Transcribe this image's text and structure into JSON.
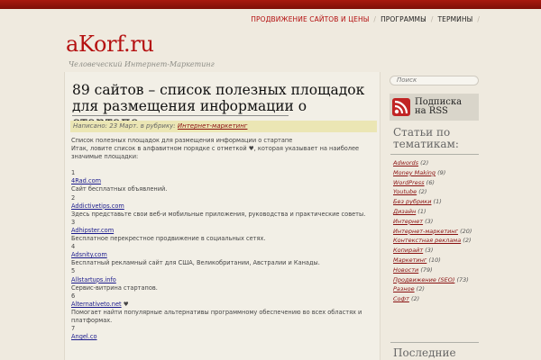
{
  "nav": {
    "items": [
      {
        "label": "ПРОДВИЖЕНИЕ САЙТОВ И ЦЕНЫ",
        "active": true
      },
      {
        "label": "ПРОГРАММЫ",
        "active": false
      },
      {
        "label": "ТЕРМИНЫ",
        "active": false
      }
    ]
  },
  "site": {
    "logo": "aKorf.ru",
    "tagline": "Человеческий Интернет-Маркетинг"
  },
  "post": {
    "title": "89 сайтов – список полезных площадок для размещения информации о стартапе",
    "meta_prefix": "Написано: 23 Март. в рубрику:",
    "meta_category": "Интернет-маркетинг",
    "intro1": "Список полезных площадок для размещения информации о стартапе",
    "intro2": "Итак, ловите список в алфавитном порядке с отметкой ♥, которая указывает на наиболее значимые площадки:",
    "entries": [
      {
        "num": "1",
        "site": "4Rad.com",
        "desc": "Сайт бесплатных объявлений."
      },
      {
        "num": "2",
        "site": "Addictivetips.com",
        "desc": "Здесь представьте свои веб-и мобильные приложения, руководства и практические советы."
      },
      {
        "num": "3",
        "site": "Adhipster.com",
        "desc": "Бесплатное перекрестное продвижение в социальных сетях."
      },
      {
        "num": "4",
        "site": "Adsnity.com",
        "desc": "Бесплатный рекламный сайт для США, Великобритании, Австралии и Канады."
      },
      {
        "num": "5",
        "site": "Allstartups.info",
        "desc": "Сервис-витрина стартапов."
      },
      {
        "num": "6",
        "site": "Alternativeto.net",
        "heart": " ♥",
        "desc": "Помогает найти популярные альтернативы программному обеспечению во всех областях и платформах."
      },
      {
        "num": "7",
        "site": "Angel.co",
        "desc": ""
      }
    ]
  },
  "sidebar": {
    "search_placeholder": "Поиск",
    "rss_line1": "Подписка",
    "rss_line2": "на RSS",
    "categories_title": "Статьи по тематикам:",
    "categories": [
      {
        "name": "Adwords",
        "count": "(2)"
      },
      {
        "name": "Money Making",
        "count": "(9)"
      },
      {
        "name": "WordPress",
        "count": "(6)"
      },
      {
        "name": "Youtube",
        "count": "(2)"
      },
      {
        "name": "Без рубрики",
        "count": "(1)"
      },
      {
        "name": "Дизайн",
        "count": "(1)"
      },
      {
        "name": "Интернет",
        "count": "(3)"
      },
      {
        "name": "Интернет-маркетинг",
        "count": "(20)"
      },
      {
        "name": "Контекстная реклама",
        "count": "(2)"
      },
      {
        "name": "Копирайт",
        "count": "(3)"
      },
      {
        "name": "Маркетинг",
        "count": "(10)"
      },
      {
        "name": "Новости",
        "count": "(79)"
      },
      {
        "name": "Продвижение (SEO)",
        "count": "(73)"
      },
      {
        "name": "Разное",
        "count": "(2)"
      },
      {
        "name": "Софт",
        "count": "(2)"
      }
    ],
    "latest_title": "Последние"
  },
  "colors": {
    "accent": "#b51010",
    "topbar": "#a8190f",
    "meta_bg": "#ebe6b4",
    "page_bg": "#efeadf"
  }
}
